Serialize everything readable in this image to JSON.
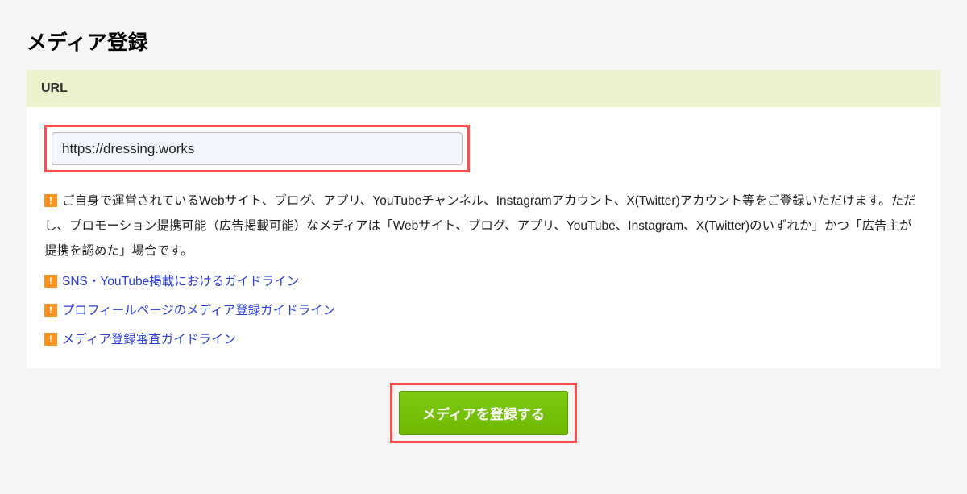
{
  "page": {
    "title": "メディア登録"
  },
  "section": {
    "header": "URL"
  },
  "form": {
    "url_value": "https://dressing.works"
  },
  "info": {
    "text": "ご自身で運営されているWebサイト、ブログ、アプリ、YouTubeチャンネル、Instagramアカウント、X(Twitter)アカウント等をご登録いただけます。ただし、プロモーション提携可能（広告掲載可能）なメディアは「Webサイト、ブログ、アプリ、YouTube、Instagram、X(Twitter)のいずれか」かつ「広告主が提携を認めた」場合です。"
  },
  "links": [
    {
      "label": "SNS・YouTube掲載におけるガイドライン"
    },
    {
      "label": "プロフィールページのメディア登録ガイドライン"
    },
    {
      "label": "メディア登録審査ガイドライン"
    }
  ],
  "button": {
    "register_label": "メディアを登録する"
  },
  "bullet": {
    "glyph": "!"
  }
}
